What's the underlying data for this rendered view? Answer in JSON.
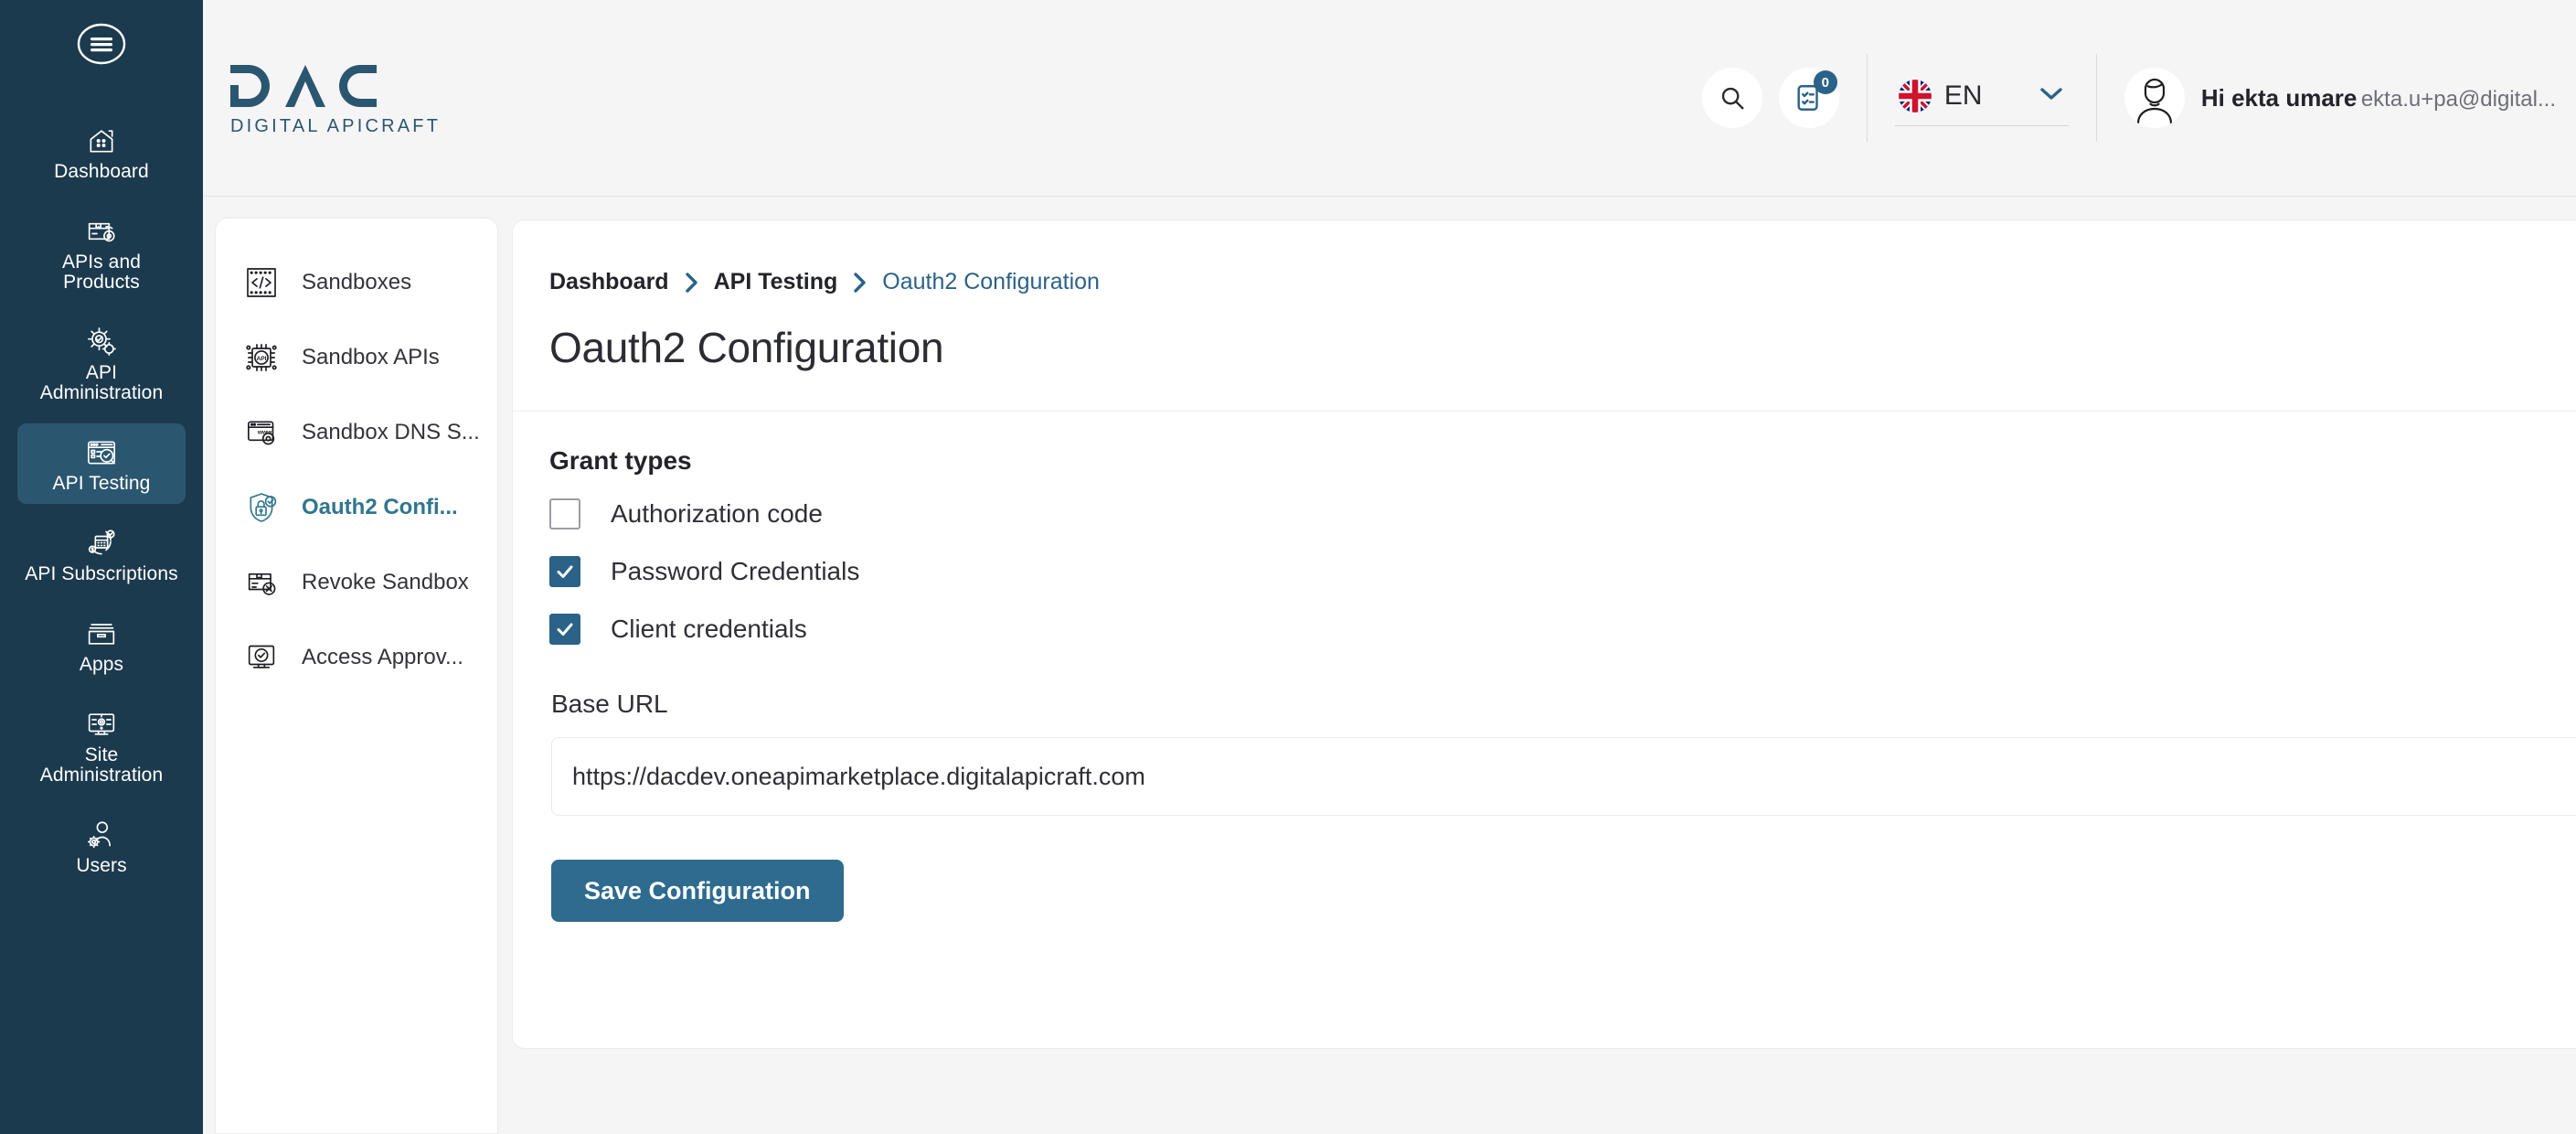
{
  "rail": {
    "menu_icon": "hamburger-circle-icon",
    "items": [
      {
        "label": "Dashboard",
        "icon": "home-dashboard-icon",
        "active": false
      },
      {
        "label": "APIs and Products",
        "icon": "package-gear-icon",
        "active": false
      },
      {
        "label": "API Administration",
        "icon": "gears-check-icon",
        "active": false
      },
      {
        "label": "API Testing",
        "icon": "form-magnifier-check-icon",
        "active": true
      },
      {
        "label": "API Subscriptions",
        "icon": "calendar-refresh-dollar-icon",
        "active": false
      },
      {
        "label": "Apps",
        "icon": "archive-box-icon",
        "active": false
      },
      {
        "label": "Site Administration",
        "icon": "monitor-gear-icon",
        "active": false
      },
      {
        "label": "Users",
        "icon": "user-gear-icon",
        "active": false
      }
    ]
  },
  "header": {
    "brand_name": "DAC",
    "brand_tagline": "DIGITAL APICRAFT",
    "search_icon": "search-icon",
    "tasks_icon": "checklist-icon",
    "tasks_badge": "0",
    "language": {
      "flag": "uk-flag-icon",
      "code": "EN",
      "chevron": "chevron-down-icon"
    },
    "user": {
      "avatar_icon": "user-avatar-icon",
      "greeting": "Hi ekta umare",
      "email": "ekta.u+pa@digital...",
      "chevron": "chevron-down-icon"
    }
  },
  "subnav": {
    "items": [
      {
        "label": "Sandboxes",
        "icon": "code-brackets-icon",
        "active": false
      },
      {
        "label": "Sandbox APIs",
        "icon": "api-chip-icon",
        "active": false
      },
      {
        "label": "Sandbox DNS S...",
        "icon": "browser-www-gear-icon",
        "active": false
      },
      {
        "label": "Oauth2 Confi...",
        "icon": "shield-lock-check-icon",
        "active": true
      },
      {
        "label": "Revoke Sandbox",
        "icon": "box-x-icon",
        "active": false
      },
      {
        "label": "Access Approv...",
        "icon": "monitor-check-icon",
        "active": false
      }
    ]
  },
  "main": {
    "breadcrumb": {
      "items": [
        "Dashboard",
        "API Testing"
      ],
      "current": "Oauth2 Configuration",
      "separator_icon": "chevron-right-icon"
    },
    "page_title": "Oauth2 Configuration",
    "grant_types": {
      "heading": "Grant types",
      "options": [
        {
          "label": "Authorization code",
          "checked": false
        },
        {
          "label": "Password Credentials",
          "checked": true
        },
        {
          "label": "Client credentials",
          "checked": true
        }
      ]
    },
    "base_url": {
      "label": "Base URL",
      "value": "https://dacdev.oneapimarketplace.digitalapicraft.com",
      "placeholder": "Base URL"
    },
    "save_label": "Save Configuration"
  },
  "colors": {
    "rail_bg": "#1c3a4e",
    "rail_active": "#2b5670",
    "accent": "#2b6288",
    "button": "#2e6b8e",
    "subnav_active_text": "#31758f",
    "page_bg": "#f5f5f6"
  }
}
